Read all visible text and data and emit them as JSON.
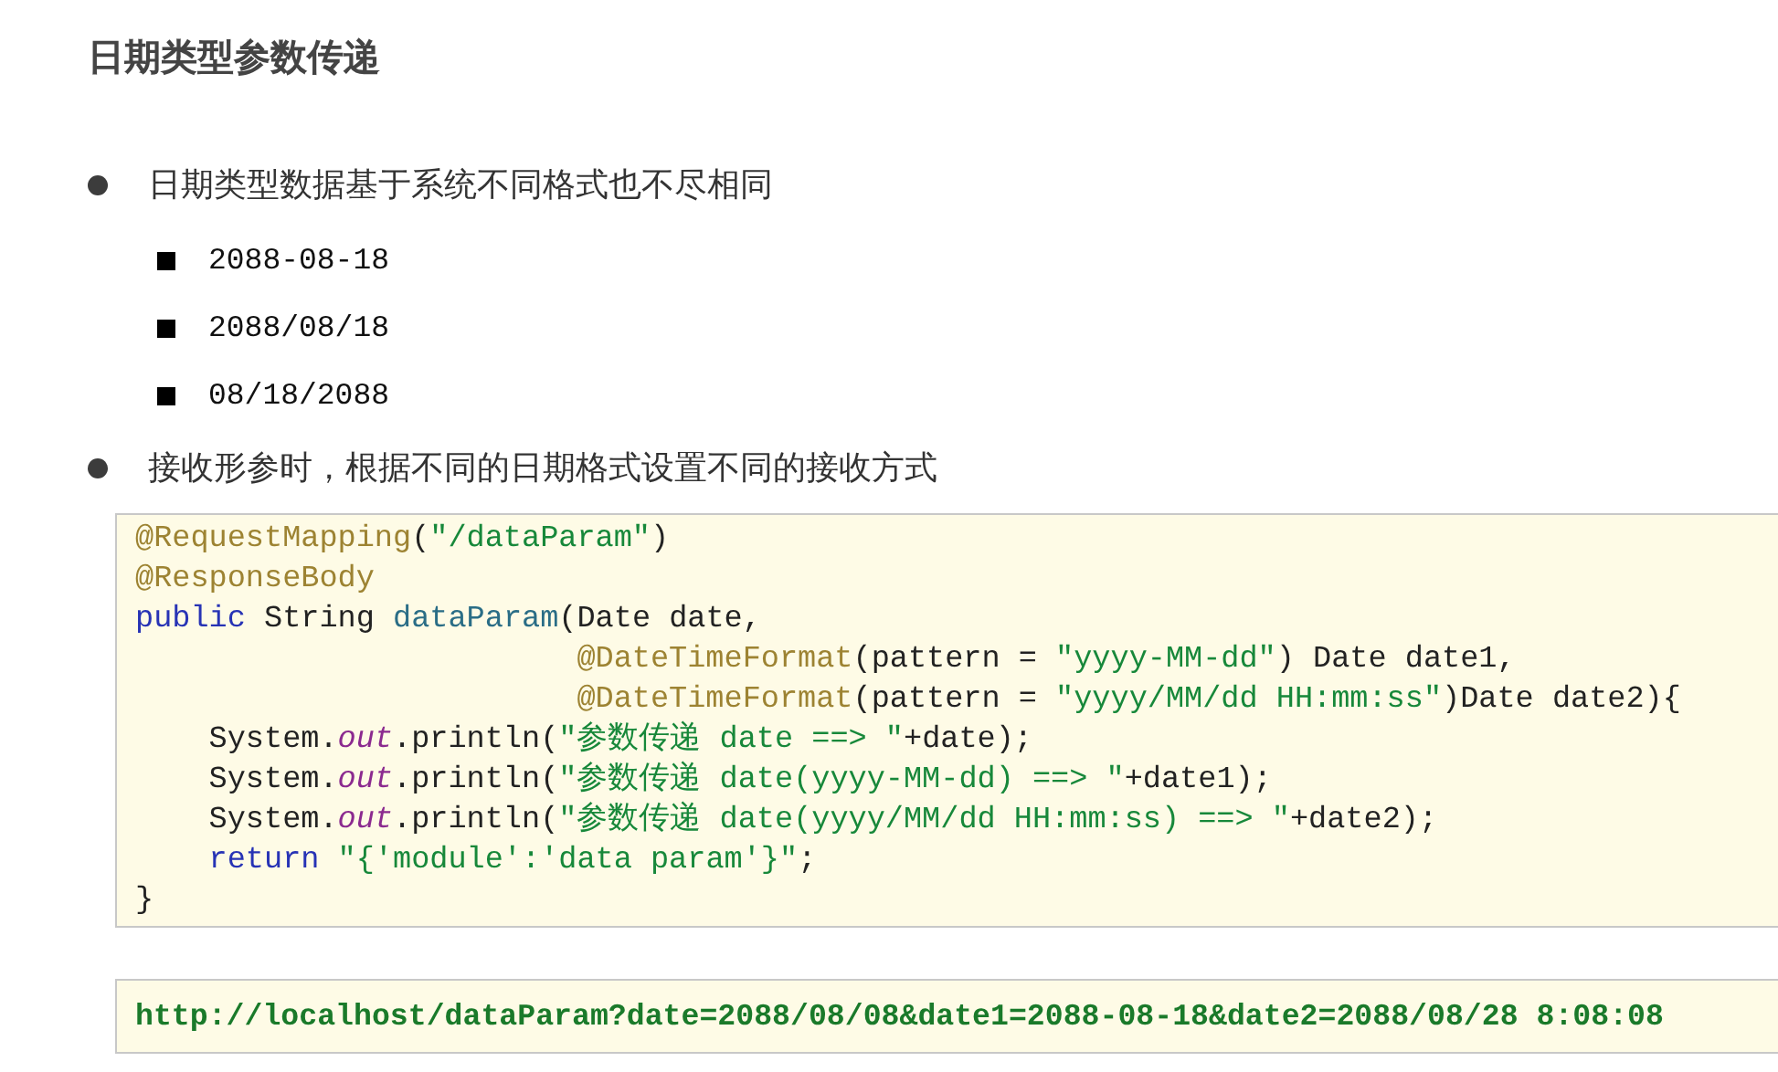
{
  "title": "日期类型参数传递",
  "bullets": [
    {
      "text": "日期类型数据基于系统不同格式也不尽相同",
      "items": [
        "2088-08-18",
        "2088/08/18",
        "08/18/2088"
      ]
    },
    {
      "text": "接收形参时，根据不同的日期格式设置不同的接收方式"
    }
  ],
  "code": {
    "lines": [
      [
        {
          "kind": "annotation",
          "text": "@RequestMapping"
        },
        {
          "kind": "plain",
          "text": "("
        },
        {
          "kind": "string",
          "text": "\"/dataParam\""
        },
        {
          "kind": "plain",
          "text": ")"
        }
      ],
      [
        {
          "kind": "annotation",
          "text": "@ResponseBody"
        }
      ],
      [
        {
          "kind": "keyword",
          "text": "public"
        },
        {
          "kind": "plain",
          "text": " String "
        },
        {
          "kind": "method",
          "text": "dataParam"
        },
        {
          "kind": "plain",
          "text": "(Date date,"
        }
      ],
      [
        {
          "kind": "annotation",
          "text": "                        @DateTimeFormat"
        },
        {
          "kind": "plain",
          "text": "(pattern = "
        },
        {
          "kind": "string",
          "text": "\"yyyy-MM-dd\""
        },
        {
          "kind": "plain",
          "text": ") Date date1,"
        }
      ],
      [
        {
          "kind": "annotation",
          "text": "                        @DateTimeFormat"
        },
        {
          "kind": "plain",
          "text": "(pattern = "
        },
        {
          "kind": "string",
          "text": "\"yyyy/MM/dd HH:mm:ss\""
        },
        {
          "kind": "plain",
          "text": ")Date date2){"
        }
      ],
      [
        {
          "kind": "plain",
          "text": "    System."
        },
        {
          "kind": "field",
          "text": "out"
        },
        {
          "kind": "plain",
          "text": ".println("
        },
        {
          "kind": "string",
          "text": "\"参数传递 date ==> \""
        },
        {
          "kind": "plain",
          "text": "+date);"
        }
      ],
      [
        {
          "kind": "plain",
          "text": "    System."
        },
        {
          "kind": "field",
          "text": "out"
        },
        {
          "kind": "plain",
          "text": ".println("
        },
        {
          "kind": "string",
          "text": "\"参数传递 date(yyyy-MM-dd) ==> \""
        },
        {
          "kind": "plain",
          "text": "+date1);"
        }
      ],
      [
        {
          "kind": "plain",
          "text": "    System."
        },
        {
          "kind": "field",
          "text": "out"
        },
        {
          "kind": "plain",
          "text": ".println("
        },
        {
          "kind": "string",
          "text": "\"参数传递 date(yyyy/MM/dd HH:mm:ss) ==> \""
        },
        {
          "kind": "plain",
          "text": "+date2);"
        }
      ],
      [
        {
          "kind": "keyword",
          "text": "    return"
        },
        {
          "kind": "string",
          "text": " \"{'module':'data param'}\""
        },
        {
          "kind": "plain",
          "text": ";"
        }
      ],
      [
        {
          "kind": "plain",
          "text": "}"
        }
      ]
    ]
  },
  "url": "http://localhost/dataParam?date=2088/08/08&date1=2088-08-18&date2=2088/08/28 8:08:08"
}
